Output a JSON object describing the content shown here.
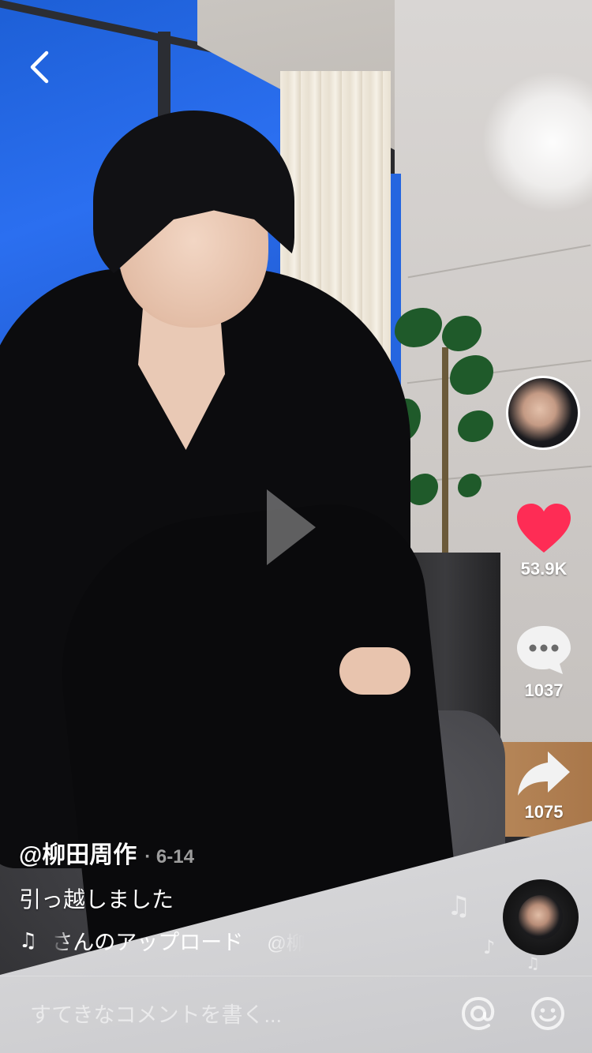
{
  "nav": {
    "back_icon": "chevron-left-icon"
  },
  "video": {
    "state": "paused",
    "play_icon": "play-icon"
  },
  "rail": {
    "like_count": "53.9K",
    "comment_count": "1037",
    "share_count": "1075",
    "like_color": "#fe2c55"
  },
  "post": {
    "username": "@柳田周作",
    "date": "· 6-14",
    "description": "引っ越しました",
    "music_text": "さんのアップロード",
    "music_credit": "@柳"
  },
  "comment_bar": {
    "placeholder": "すてきなコメントを書く...",
    "mention_icon": "at-sign-icon",
    "emoji_icon": "emoji-icon"
  }
}
